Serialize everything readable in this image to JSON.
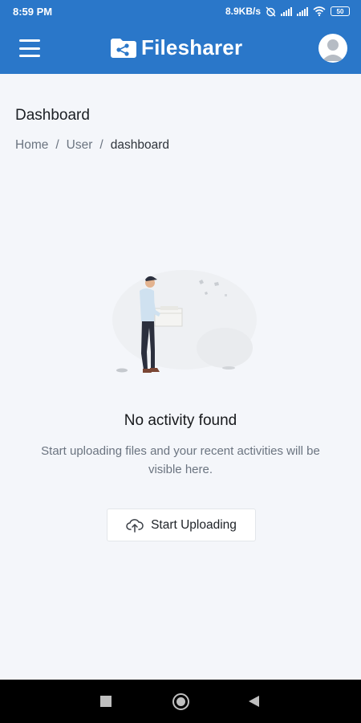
{
  "status_bar": {
    "time": "8:59 PM",
    "network_speed": "8.9KB/s",
    "battery_level": "50",
    "icons": [
      "alarm-off-icon",
      "signal-icon",
      "signal-icon",
      "wifi-icon",
      "battery-icon"
    ]
  },
  "app_bar": {
    "brand_name": "Filesharer",
    "icons": {
      "menu": "hamburger-menu-icon",
      "logo": "folder-share-icon",
      "avatar": "user-avatar-icon"
    }
  },
  "page": {
    "title": "Dashboard",
    "breadcrumb": [
      {
        "label": "Home"
      },
      {
        "label": "User"
      },
      {
        "label": "dashboard"
      }
    ],
    "separator": "/"
  },
  "empty_state": {
    "title": "No activity found",
    "description": "Start uploading files and your recent activities will be visible here.",
    "button_label": "Start Uploading",
    "button_icon": "cloud-upload-icon"
  },
  "nav_bar": {
    "icons": [
      "recents-square-icon",
      "home-circle-icon",
      "back-triangle-icon"
    ]
  },
  "colors": {
    "primary": "#2a77c9",
    "background": "#f4f6fa",
    "text_dark": "#17191c",
    "text_muted": "#6b7480"
  }
}
